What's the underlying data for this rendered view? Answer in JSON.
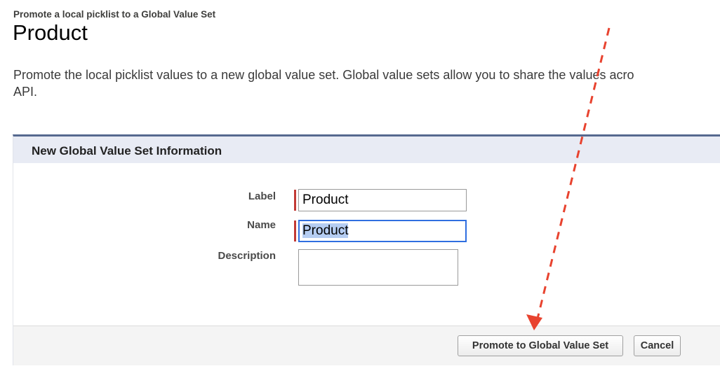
{
  "header": {
    "breadcrumb": "Promote a local picklist to a Global Value Set",
    "title": "Product"
  },
  "intro": {
    "line1": "Promote the local picklist values to a new global value set. Global value sets allow you to share the values acro",
    "line2": "API."
  },
  "section": {
    "title": "New Global Value Set Information",
    "fields": {
      "label": {
        "label": "Label",
        "value": "Product",
        "required": true
      },
      "name": {
        "label": "Name",
        "value": "Product",
        "required": true,
        "focused": true,
        "selected": true
      },
      "description": {
        "label": "Description",
        "value": ""
      }
    }
  },
  "buttons": {
    "promote": "Promote to Global Value Set",
    "cancel": "Cancel"
  },
  "colors": {
    "required": "#c23934",
    "focus": "#2f6ee0",
    "annotation_arrow": "#e8432f",
    "section_header_bg": "#e8ebf4",
    "section_border": "#56698f"
  },
  "annotation": {
    "type": "dashed-arrow",
    "points_to": "promote-button"
  }
}
